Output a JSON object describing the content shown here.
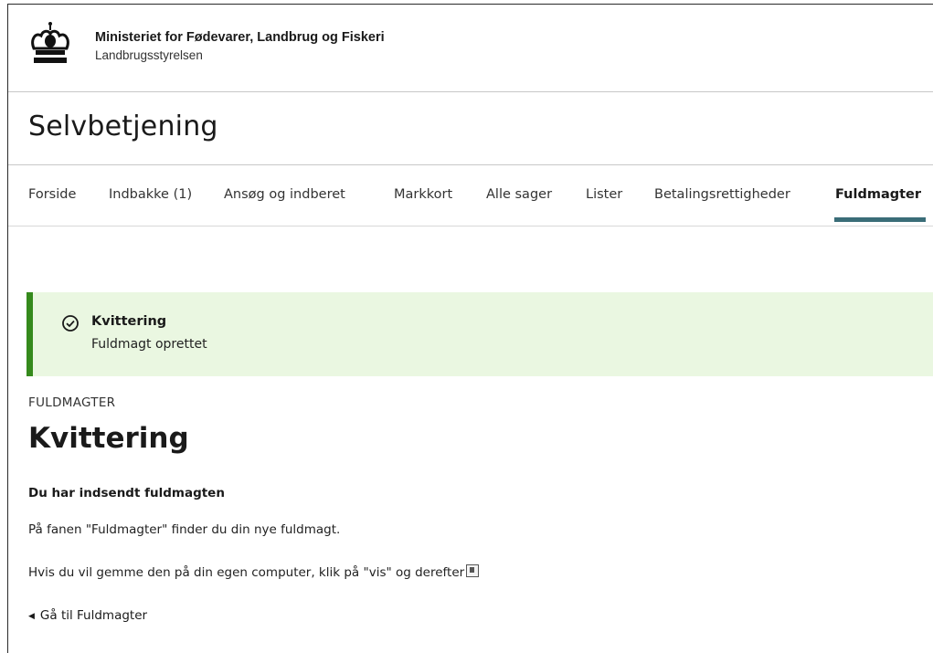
{
  "header": {
    "ministry_name": "Ministeriet for Fødevarer, Landbrug og Fiskeri",
    "agency_name": "Landbrugsstyrelsen",
    "logo_icon": "crown-icon"
  },
  "site": {
    "title": "Selvbetjening"
  },
  "nav": {
    "items": [
      {
        "label": "Forside"
      },
      {
        "label": "Indbakke (1)"
      },
      {
        "label": "Ansøg og indberet"
      },
      {
        "label": "Markkort"
      },
      {
        "label": "Alle sager"
      },
      {
        "label": "Lister"
      },
      {
        "label": "Betalingsrettigheder"
      },
      {
        "label": "Fuldmagter"
      }
    ],
    "active": "Fuldmagter"
  },
  "alert": {
    "icon": "check-circle-icon",
    "heading": "Kvittering",
    "text": "Fuldmagt oprettet",
    "background": "#eaf7e1",
    "accent": "#358a1c"
  },
  "main": {
    "eyebrow": "FULDMAGTER",
    "title": "Kvittering",
    "subheading": "Du har indsendt fuldmagten",
    "paragraph1": "På fanen \"Fuldmagter\" finder du din nye fuldmagt.",
    "paragraph2": "Hvis du vil gemme den på din egen computer, klik på \"vis\" og derefter",
    "paragraph2_icon": "download-icon",
    "back_link": "Gå til Fuldmagter"
  },
  "colors": {
    "nav_active_underline": "#3a6d78"
  }
}
